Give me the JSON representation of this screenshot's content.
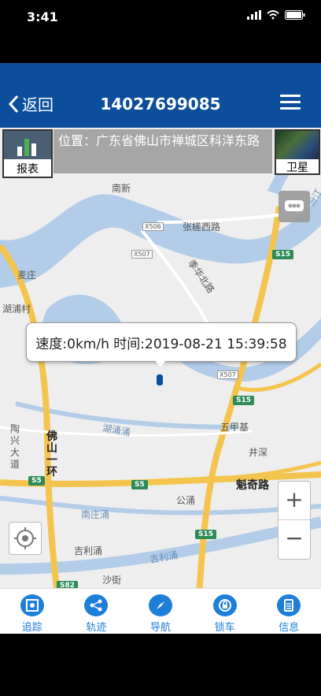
{
  "status": {
    "time": "3:41"
  },
  "nav": {
    "back_label": "返回",
    "title": "14027699085"
  },
  "map_overlay": {
    "report_label": "报表",
    "location_text": "位置：广东省佛山市禅城区科洋东路",
    "satellite_label": "卫星"
  },
  "bubble": {
    "text": "速度:0km/h 时间:2019-08-21 15:39:58"
  },
  "map_labels": {
    "nanxin": "南新",
    "zhangcha_west": "张槎西路",
    "jihua_north": "季华北路",
    "maizhuang": "麦庄",
    "hutou": "湖浦村",
    "wujiaji": "五甲基",
    "jingshen": "井深",
    "taoxing": "陶兴大道",
    "foshan_ring": "佛山一环",
    "kuiqi": "魁奇路",
    "gongyong": "公涌",
    "nanzhuang": "南庄涌",
    "jili_village": "吉利涌",
    "jili_river": "吉利涌",
    "shajie": "沙街",
    "huyong": "湖涌涌",
    "fenjiang": "汾江"
  },
  "shields": {
    "x506": "X506",
    "x507a": "X507",
    "x507b": "X507",
    "s15a": "S15",
    "s15b": "S15",
    "s15c": "S15",
    "s5a": "S5",
    "s5b": "S5",
    "s82": "S82"
  },
  "zoom": {
    "plus": "+",
    "minus": "−"
  },
  "tabs": [
    {
      "label": "追踪",
      "icon": "track-target-icon"
    },
    {
      "label": "轨迹",
      "icon": "share-route-icon"
    },
    {
      "label": "导航",
      "icon": "compass-icon"
    },
    {
      "label": "锁车",
      "icon": "lock-car-icon"
    },
    {
      "label": "信息",
      "icon": "document-icon"
    }
  ],
  "colors": {
    "nav": "#0b4f9c",
    "tab_accent": "#1e7fd8",
    "road": "#f4c54e",
    "water": "#b3cde8"
  }
}
